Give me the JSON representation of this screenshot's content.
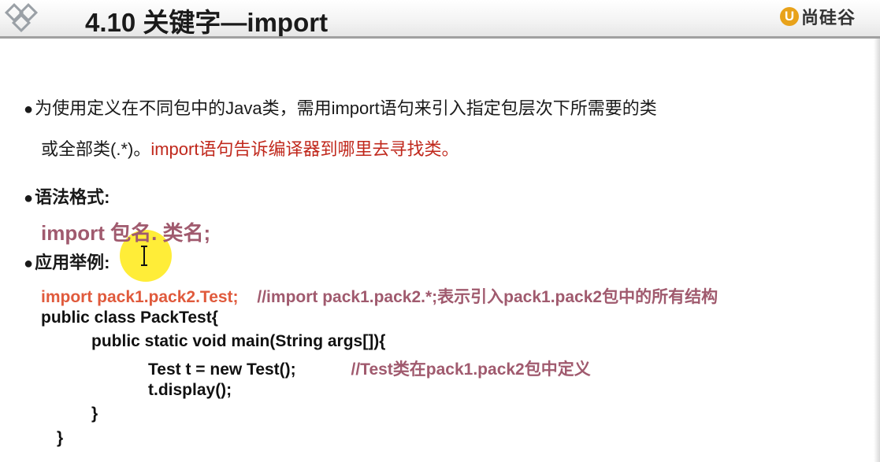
{
  "header": {
    "title": "4.10 关键字—import",
    "brand_mark": "U",
    "brand_text": "尚硅谷"
  },
  "bullet1": {
    "line1": "为使用定义在不同包中的Java类，需用import语句来引入指定包层次下所需要的类",
    "line2_black": "或全部类(.*)。",
    "line2_red": "import语句告诉编译器到哪里去寻找类。"
  },
  "bullet2": {
    "label": "语法格式:",
    "syntax": "import  包名. 类名;"
  },
  "bullet3": {
    "label": "应用举例:"
  },
  "code": {
    "line1_stmt": "import  pack1.pack2.Test;",
    "line1_comment": "//import pack1.pack2.*;表示引入pack1.pack2包中的所有结构",
    "line2": "public class PackTest{",
    "line3": "public static void main(String args[]){",
    "line4_stmt": "Test t = new Test();",
    "line4_comment": "//Test类在pack1.pack2包中定义",
    "line5": "t.display();",
    "line6": "}",
    "line7": "}"
  },
  "colors": {
    "accent_red": "#c0281c",
    "code_red": "#e05a3c",
    "comment_mauve": "#a05a6e",
    "highlight_yellow": "#ffe800",
    "brand_orange": "#e8a21a"
  },
  "icons": [
    "diamond-logo-icon",
    "brand-u-icon",
    "text-cursor-icon",
    "cursor-highlight"
  ]
}
